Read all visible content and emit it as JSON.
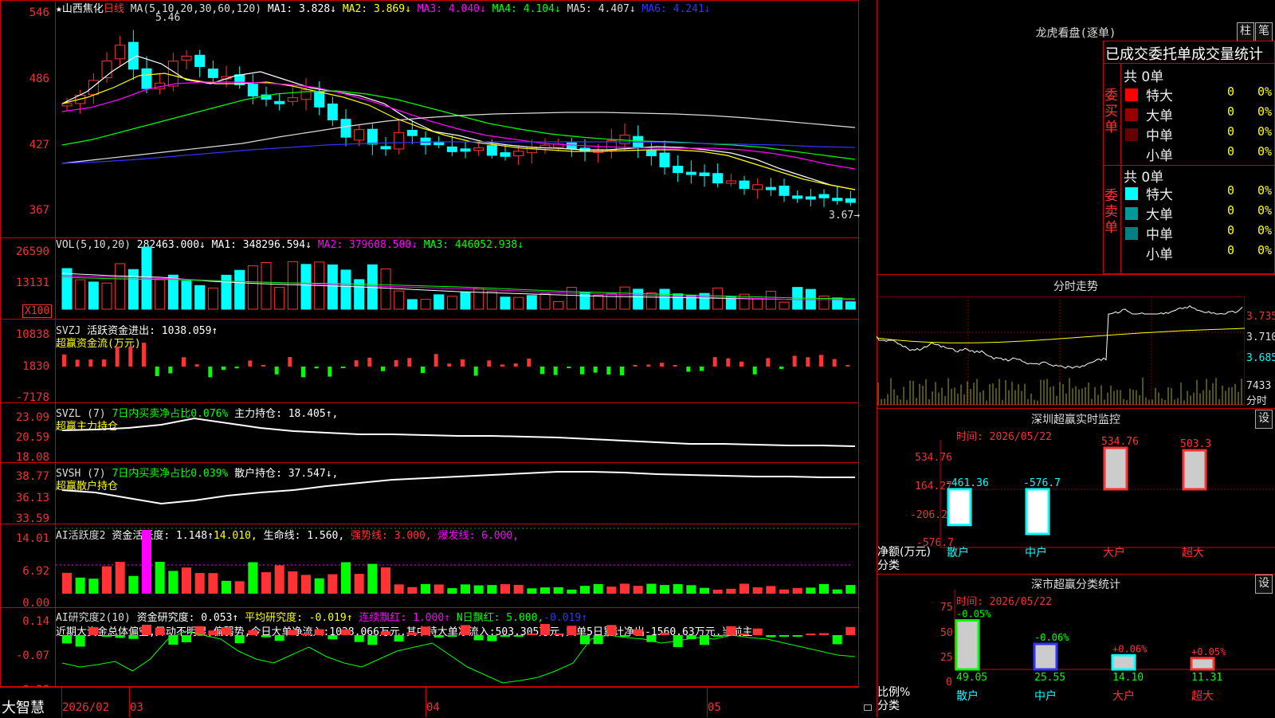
{
  "stock": {
    "star": "★",
    "name": "山西焦化",
    "period": "日线",
    "ma_spec": "MA(5,10,20,30,60,120)",
    "ma": [
      {
        "label": "MA1: 3.828↓",
        "color": "#ffffff"
      },
      {
        "label": "MA2: 3.869↓",
        "color": "#ffff00"
      },
      {
        "label": "MA3: 4.040↓",
        "color": "#ff00ff"
      },
      {
        "label": "MA4: 4.104↓",
        "color": "#00ff00"
      },
      {
        "label": "MA5: 4.407↓",
        "color": "#dddddd"
      },
      {
        "label": "MA6: 4.241↓",
        "color": "#3333ff"
      }
    ],
    "high_mark": "5.46",
    "low_mark": "3.67→"
  },
  "price_axis": [
    "546",
    "486",
    "427",
    "367"
  ],
  "vol": {
    "header": "VOL(5,10,20)",
    "value": "282463.000↓",
    "ma1": "MA1: 348296.594↓",
    "ma2": "MA2: 379608.500↓",
    "ma3": "MA3: 446052.938↓",
    "axis": [
      "26590",
      "13131"
    ],
    "unit": "X100"
  },
  "svzj": {
    "header": "SVZJ",
    "label": "活跃资金进出: 1038.059↑",
    "sub": "超赢资金流(万元)",
    "axis": [
      "10838",
      "1830",
      "-7178"
    ]
  },
  "svzl": {
    "header": "SVZL (7)",
    "label": "7日内买卖净占比0.076%",
    "label2": "主力持仓: 18.405↑,",
    "sub": "超赢主力持仓",
    "axis": [
      "23.09",
      "20.59",
      "18.08"
    ]
  },
  "svsh": {
    "header": "SVSH (7)",
    "label": "7日内买卖净占比0.039%",
    "label2": "散户持仓: 37.547↓,",
    "sub": "超赢散户持仓",
    "axis": [
      "38.77",
      "36.13",
      "33.59"
    ]
  },
  "ai1": {
    "header": "AI活跃度2",
    "a": "资金活跃度: 1.148↑",
    "b": "14.010,",
    "c": "生命线: 1.560,",
    "d": "强势线: 3.000,",
    "e": "爆发线: 6.000,",
    "axis": [
      "14.01",
      "6.92",
      "0.00"
    ]
  },
  "ai2": {
    "header": "AI研究度2(10)",
    "a": "资金研究度: 0.053↑",
    "b": "平均研究度: -0.019↑",
    "c": "连续飘红: 1.000↑",
    "d": "N日飘红: 5.000,",
    "e": "-0.019↑",
    "text": "近期大资金总体偏空,异动不明显,偏弱势,今日大单净流入:1038.066万元,其中特大单净流入:503.305万元,大单5日累计净出-1560.63万元,当前主",
    "axis": [
      "0.14",
      "-0.07",
      "-0.28"
    ]
  },
  "bottom": {
    "brand": "大智慧",
    "dates": [
      "2026/02",
      "03",
      "04",
      "05"
    ]
  },
  "right": {
    "dragon_title": "龙虎看盘(逐单)",
    "btn_bar": "柱",
    "btn_pen": "笔",
    "stat_title": "已成交委托单成交量统计",
    "buy_side": "委买单",
    "sell_side": "委卖单",
    "buy_total": "共 0单",
    "sell_total": "共 0单",
    "buy_rows": [
      {
        "label": "特大",
        "n": "0",
        "pct": "0%",
        "color": "#ff0000"
      },
      {
        "label": "大单",
        "n": "0",
        "pct": "0%",
        "color": "#990000"
      },
      {
        "label": "中单",
        "n": "0",
        "pct": "0%",
        "color": "#660000"
      },
      {
        "label": "小单",
        "n": "0",
        "pct": "0%",
        "color": ""
      }
    ],
    "sell_rows": [
      {
        "label": "特大",
        "n": "0",
        "pct": "0%",
        "color": "#00ffff"
      },
      {
        "label": "大单",
        "n": "0",
        "pct": "0%",
        "color": "#009999"
      },
      {
        "label": "中单",
        "n": "0",
        "pct": "0%",
        "color": "#008080"
      },
      {
        "label": "小单",
        "n": "0",
        "pct": "0%",
        "color": ""
      }
    ],
    "intraday_title": "分时走势",
    "intraday_axis": [
      "3.735",
      "3.710",
      "3.685",
      "7433"
    ],
    "intraday_unit": "分时",
    "monitor_title": "深圳超赢实时监控",
    "monitor_btn": "设",
    "monitor_date": "时间: 2026/05/22",
    "monitor_axis": [
      "534.76",
      "164.27",
      "-206.21",
      "-576.7"
    ],
    "monitor_ylabel": "净额(万元)",
    "monitor_xlabel": "分类",
    "class_title": "深市超赢分类统计",
    "class_btn": "设",
    "class_date": "时间: 2026/05/22",
    "class_axis": [
      "75",
      "50",
      "25",
      "0"
    ],
    "class_ylabel": "比例%",
    "class_xlabel": "分类"
  },
  "chart_data": [
    {
      "type": "bar",
      "title": "深圳超赢实时监控",
      "categories": [
        "散户",
        "中户",
        "大户",
        "超大"
      ],
      "values": [
        -461.36,
        -576.7,
        534.76,
        503.3
      ],
      "ylim": [
        -576.7,
        534.76
      ]
    },
    {
      "type": "bar",
      "title": "深市超赢分类统计",
      "categories": [
        "散户",
        "中户",
        "大户",
        "超大"
      ],
      "series": [
        {
          "values": [
            49.05,
            25.55,
            14.1,
            11.31
          ]
        },
        {
          "values": [
            -0.05,
            -0.06,
            0.06,
            0.05
          ]
        }
      ],
      "ylim": [
        0,
        75
      ]
    }
  ]
}
